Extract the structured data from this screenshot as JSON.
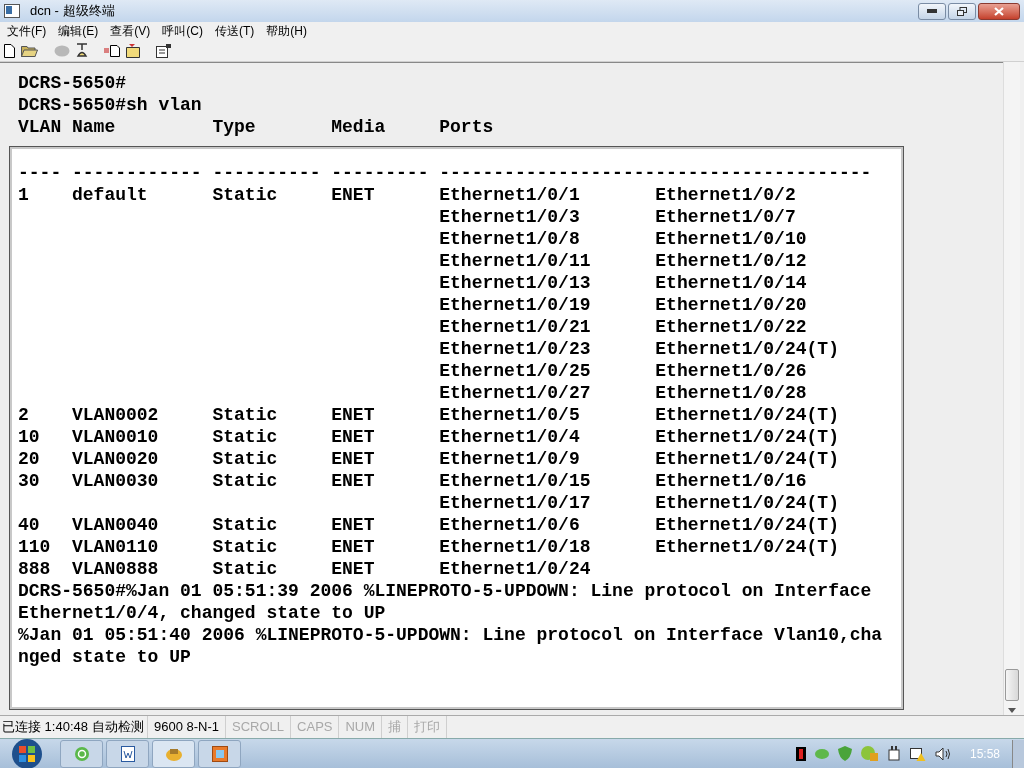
{
  "window": {
    "title": "dcn - 超级终端"
  },
  "menu": [
    "文件(F)",
    "编辑(E)",
    "查看(V)",
    "呼叫(C)",
    "传送(T)",
    "帮助(H)"
  ],
  "terminal": {
    "lines": [
      "DCRS-5650#",
      "DCRS-5650#sh vlan",
      "VLAN Name         Type       Media     Ports"
    ],
    "panel_lines": [
      "---- ------------ ---------- --------- ----------------------------------------",
      "1    default      Static     ENET      Ethernet1/0/1       Ethernet1/0/2",
      "                                       Ethernet1/0/3       Ethernet1/0/7",
      "                                       Ethernet1/0/8       Ethernet1/0/10",
      "                                       Ethernet1/0/11      Ethernet1/0/12",
      "                                       Ethernet1/0/13      Ethernet1/0/14",
      "                                       Ethernet1/0/19      Ethernet1/0/20",
      "                                       Ethernet1/0/21      Ethernet1/0/22",
      "                                       Ethernet1/0/23      Ethernet1/0/24(T)",
      "                                       Ethernet1/0/25      Ethernet1/0/26",
      "                                       Ethernet1/0/27      Ethernet1/0/28",
      "2    VLAN0002     Static     ENET      Ethernet1/0/5       Ethernet1/0/24(T)",
      "10   VLAN0010     Static     ENET      Ethernet1/0/4       Ethernet1/0/24(T)",
      "20   VLAN0020     Static     ENET      Ethernet1/0/9       Ethernet1/0/24(T)",
      "30   VLAN0030     Static     ENET      Ethernet1/0/15      Ethernet1/0/16",
      "                                       Ethernet1/0/17      Ethernet1/0/24(T)",
      "40   VLAN0040     Static     ENET      Ethernet1/0/6       Ethernet1/0/24(T)",
      "110  VLAN0110     Static     ENET      Ethernet1/0/18      Ethernet1/0/24(T)",
      "888  VLAN0888     Static     ENET      Ethernet1/0/24",
      "DCRS-5650#%Jan 01 05:51:39 2006 %LINEPROTO-5-UPDOWN: Line protocol on Interface",
      "Ethernet1/0/4, changed state to UP",
      "%Jan 01 05:51:40 2006 %LINEPROTO-5-UPDOWN: Line protocol on Interface Vlan10,cha",
      "nged state to UP"
    ]
  },
  "status_bar": [
    {
      "text": "已连接 1:40:48 自动检测",
      "disabled": false
    },
    {
      "text": "9600 8-N-1",
      "disabled": false
    },
    {
      "text": "SCROLL",
      "disabled": true
    },
    {
      "text": "CAPS",
      "disabled": true
    },
    {
      "text": "NUM",
      "disabled": true
    },
    {
      "text": "捕",
      "disabled": true
    },
    {
      "text": "打印",
      "disabled": true
    }
  ],
  "taskbar": {
    "clock": "15:58"
  }
}
